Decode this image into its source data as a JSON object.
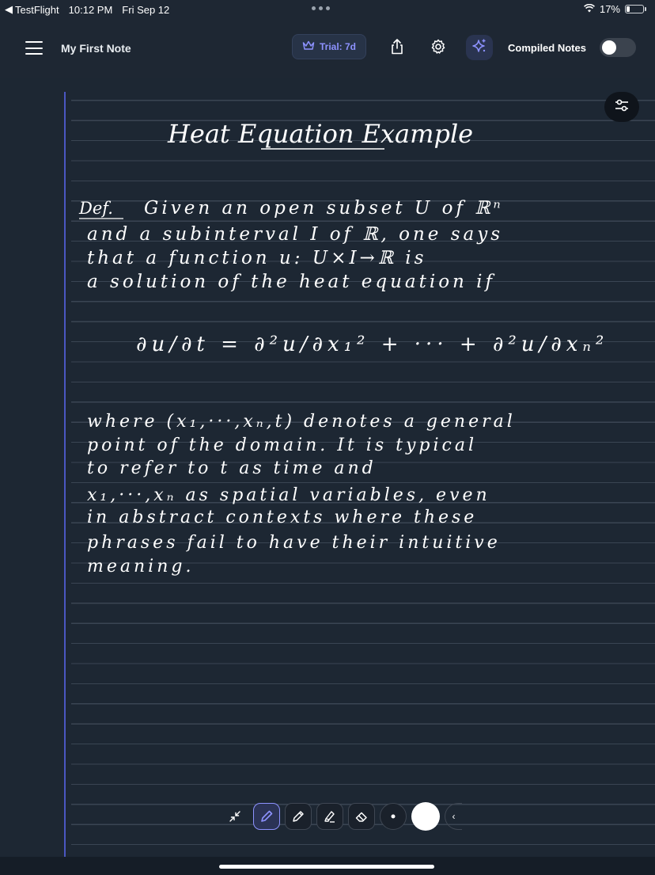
{
  "status_bar": {
    "back_app": "TestFlight",
    "time": "10:12 PM",
    "date": "Fri Sep 12",
    "battery": "17%"
  },
  "toolbar": {
    "note_title": "My First Note",
    "trial_label": "Trial: 7d",
    "compiled_label": "Compiled Notes",
    "compiled_enabled": false
  },
  "note": {
    "title": "Heat Equation Example",
    "definition_label": "Def.",
    "definition": [
      "Given an open subset U of ℝⁿ",
      "and a subinterval I of ℝ, one says",
      "that a function u: U×I→ℝ is",
      "a solution of the heat equation if"
    ],
    "equation": "∂u/∂t = ∂²u/∂x₁² + ··· + ∂²u/∂xₙ²",
    "paragraph": [
      "where (x₁,···,xₙ,t) denotes a general",
      "point of the domain. It is typical",
      "to refer to t as time and",
      "x₁,···,xₙ as spatial variables, even",
      "in abstract contexts where these",
      "phrases fail to have their intuitive",
      "meaning."
    ]
  },
  "pen_tools": {
    "items": [
      "collapse-icon",
      "pen-icon",
      "pencil-icon",
      "highlighter-icon",
      "eraser-icon",
      "small-dot-icon",
      "white-color-swatch",
      "chevron-left-icon"
    ],
    "active": "pen-icon",
    "active_color": "#ffffff"
  },
  "colors": {
    "accent": "#8d92ff",
    "background": "#1d2733",
    "margin_line": "#4b57c2"
  }
}
